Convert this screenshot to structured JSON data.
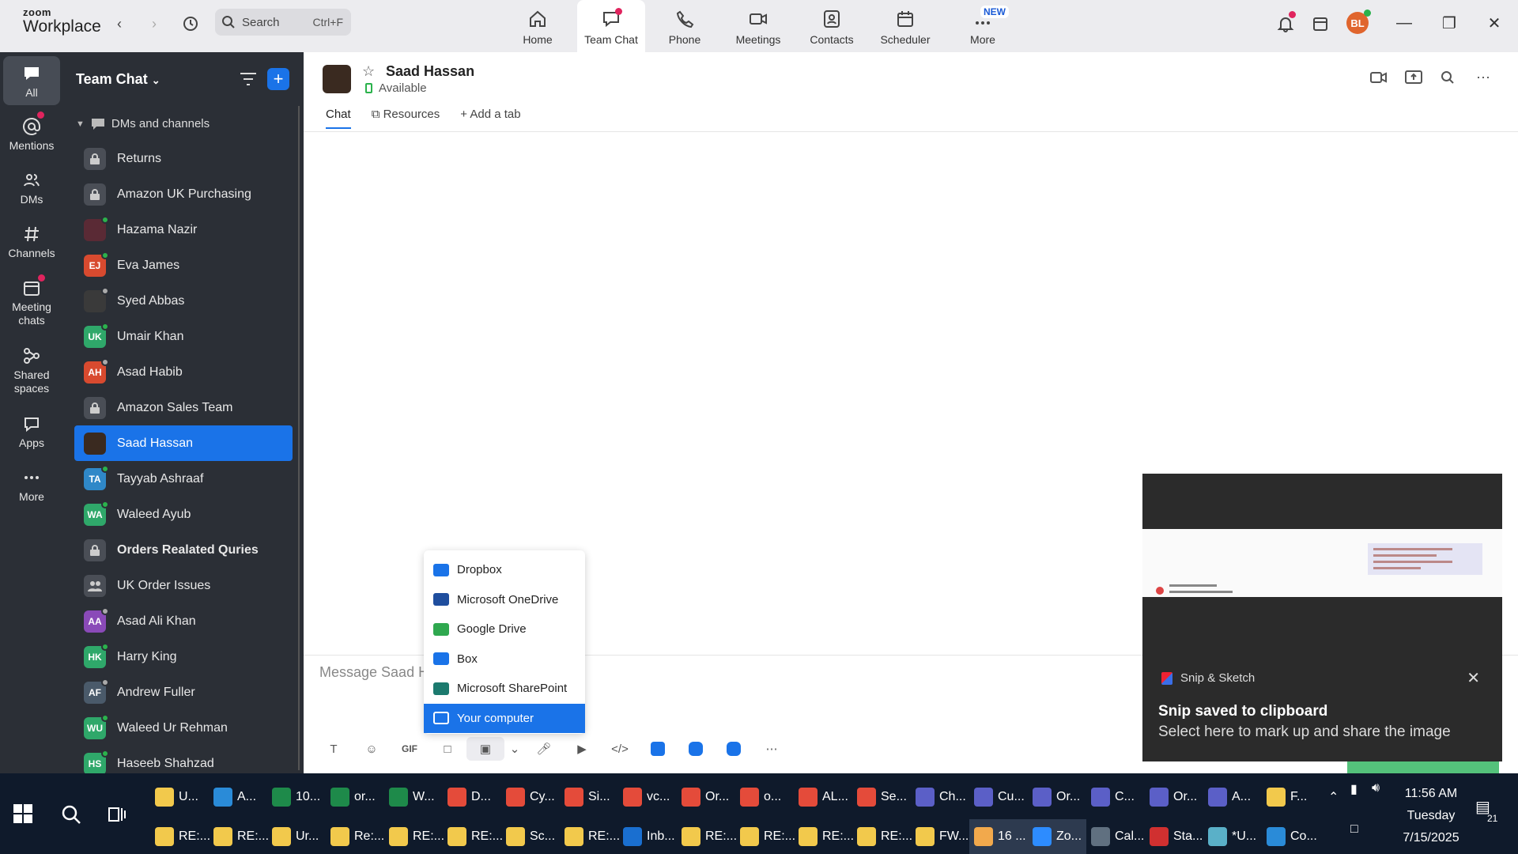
{
  "app": {
    "brand_top": "zoom",
    "brand_bottom": "Workplace",
    "search_placeholder": "Search",
    "search_shortcut": "Ctrl+F",
    "profile_initials": "BL",
    "new_tag": "NEW",
    "top_nav": [
      {
        "label": "Home",
        "icon": "home-icon"
      },
      {
        "label": "Team Chat",
        "icon": "chat-icon",
        "active": true
      },
      {
        "label": "Phone",
        "icon": "phone-icon"
      },
      {
        "label": "Meetings",
        "icon": "video-icon"
      },
      {
        "label": "Contacts",
        "icon": "contacts-icon"
      },
      {
        "label": "Scheduler",
        "icon": "calendar-icon"
      },
      {
        "label": "More",
        "icon": "more-icon"
      }
    ]
  },
  "rail": [
    {
      "label": "All",
      "active": true
    },
    {
      "label": "Mentions"
    },
    {
      "label": "DMs"
    },
    {
      "label": "Channels"
    },
    {
      "label": "Meeting chats"
    },
    {
      "label": "Shared spaces"
    },
    {
      "label": "Apps"
    },
    {
      "label": "More"
    }
  ],
  "panel": {
    "title": "Team Chat",
    "section": "DMs and channels",
    "items": [
      {
        "name": "Returns",
        "type": "lock"
      },
      {
        "name": "Amazon UK Purchasing",
        "type": "lock"
      },
      {
        "name": "Hazama Nazir",
        "type": "photo",
        "color": "#5a2a35",
        "status": "green"
      },
      {
        "name": "Eva James",
        "initials": "EJ",
        "color": "#d84a2f",
        "status": "green"
      },
      {
        "name": "Syed Abbas",
        "type": "photo",
        "color": "#3a3a3a",
        "status": "grey"
      },
      {
        "name": "Umair Khan",
        "initials": "UK",
        "color": "#2fa86a",
        "status": "green"
      },
      {
        "name": "Asad Habib",
        "initials": "AH",
        "color": "#d84a2f",
        "status": "grey"
      },
      {
        "name": "Amazon Sales Team",
        "type": "lock"
      },
      {
        "name": "Saad Hassan",
        "type": "photo",
        "color": "#3a2a20",
        "active": true
      },
      {
        "name": "Tayyab Ashraaf",
        "initials": "TA",
        "color": "#2f88c8",
        "status": "green"
      },
      {
        "name": "Waleed Ayub",
        "initials": "WA",
        "color": "#2fa86a",
        "status": "green"
      },
      {
        "name": "Orders Realated Quries",
        "type": "lock",
        "bold": true
      },
      {
        "name": "UK Order Issues",
        "type": "group"
      },
      {
        "name": "Asad Ali Khan",
        "initials": "AA",
        "color": "#8a4ab8",
        "status": "grey"
      },
      {
        "name": "Harry King",
        "initials": "HK",
        "color": "#2fa86a",
        "status": "green"
      },
      {
        "name": "Andrew Fuller",
        "initials": "AF",
        "color": "#4a5a6a",
        "status": "grey"
      },
      {
        "name": "Waleed Ur Rehman",
        "initials": "WU",
        "color": "#2fa86a",
        "status": "green"
      },
      {
        "name": "Haseeb Shahzad",
        "initials": "HS",
        "color": "#2fa86a",
        "status": "green"
      }
    ]
  },
  "chat": {
    "contact_name": "Saad Hassan",
    "status": "Available",
    "tabs": [
      "Chat",
      "Resources",
      "Add a tab"
    ],
    "message_placeholder": "Message Saad H",
    "toolbar_gif": "GIF",
    "toolbar_code": "</>"
  },
  "dropdown": [
    {
      "label": "Dropbox",
      "color": "#1a73e8"
    },
    {
      "label": "Microsoft OneDrive",
      "color": "#1f4e9e"
    },
    {
      "label": "Google Drive",
      "color": "#2fa84f"
    },
    {
      "label": "Box",
      "color": "#1a73e8"
    },
    {
      "label": "Microsoft SharePoint",
      "color": "#1c7a6e"
    },
    {
      "label": "Your computer",
      "color": "#ffffff",
      "active": true
    }
  ],
  "snip": {
    "app_name": "Snip & Sketch",
    "title": "Snip saved to clipboard",
    "subtitle": "Select here to mark up and share the image"
  },
  "taskbar": {
    "row1": [
      {
        "label": "U...",
        "color": "#f2c94c"
      },
      {
        "label": "A...",
        "color": "#2a8bd8"
      },
      {
        "label": "10...",
        "color": "#1e8a4a"
      },
      {
        "label": "or...",
        "color": "#1e8a4a"
      },
      {
        "label": "W...",
        "color": "#1e8a4a"
      },
      {
        "label": "D...",
        "color": "#e44b3a"
      },
      {
        "label": "Cy...",
        "color": "#e44b3a"
      },
      {
        "label": "Si...",
        "color": "#e44b3a"
      },
      {
        "label": "vc...",
        "color": "#e44b3a"
      },
      {
        "label": "Or...",
        "color": "#e44b3a"
      },
      {
        "label": "o...",
        "color": "#e44b3a"
      },
      {
        "label": "AL...",
        "color": "#e44b3a"
      },
      {
        "label": "Se...",
        "color": "#e44b3a"
      },
      {
        "label": "Ch...",
        "color": "#5b5fc7"
      },
      {
        "label": "Cu...",
        "color": "#5b5fc7"
      },
      {
        "label": "Or...",
        "color": "#5b5fc7"
      },
      {
        "label": "C...",
        "color": "#5b5fc7"
      },
      {
        "label": "Or...",
        "color": "#5b5fc7"
      },
      {
        "label": "A...",
        "color": "#5b5fc7"
      },
      {
        "label": "F...",
        "color": "#f2c94c"
      }
    ],
    "row2": [
      {
        "label": "RE:...",
        "color": "#f2c94c"
      },
      {
        "label": "RE:...",
        "color": "#f2c94c"
      },
      {
        "label": "Ur...",
        "color": "#f2c94c"
      },
      {
        "label": "Re:...",
        "color": "#f2c94c"
      },
      {
        "label": "RE:...",
        "color": "#f2c94c"
      },
      {
        "label": "RE:...",
        "color": "#f2c94c"
      },
      {
        "label": "Sc...",
        "color": "#f2c94c"
      },
      {
        "label": "RE:...",
        "color": "#f2c94c"
      },
      {
        "label": "Inb...",
        "color": "#1a6fd0"
      },
      {
        "label": "RE:...",
        "color": "#f2c94c"
      },
      {
        "label": "RE:...",
        "color": "#f2c94c"
      },
      {
        "label": "RE:...",
        "color": "#f2c94c"
      },
      {
        "label": "RE:...",
        "color": "#f2c94c"
      },
      {
        "label": "FW...",
        "color": "#f2c94c"
      },
      {
        "label": "16 ...",
        "color": "#f2a94c",
        "active": true
      },
      {
        "label": "Zo...",
        "color": "#2d8cff",
        "active": true
      },
      {
        "label": "Cal...",
        "color": "#607080"
      },
      {
        "label": "Sta...",
        "color": "#d03030"
      },
      {
        "label": "*U...",
        "color": "#5ab0c8"
      },
      {
        "label": "Co...",
        "color": "#2a8bd8"
      }
    ],
    "time": "11:56 AM",
    "day": "Tuesday",
    "date": "7/15/2025",
    "notif_count": "21"
  }
}
